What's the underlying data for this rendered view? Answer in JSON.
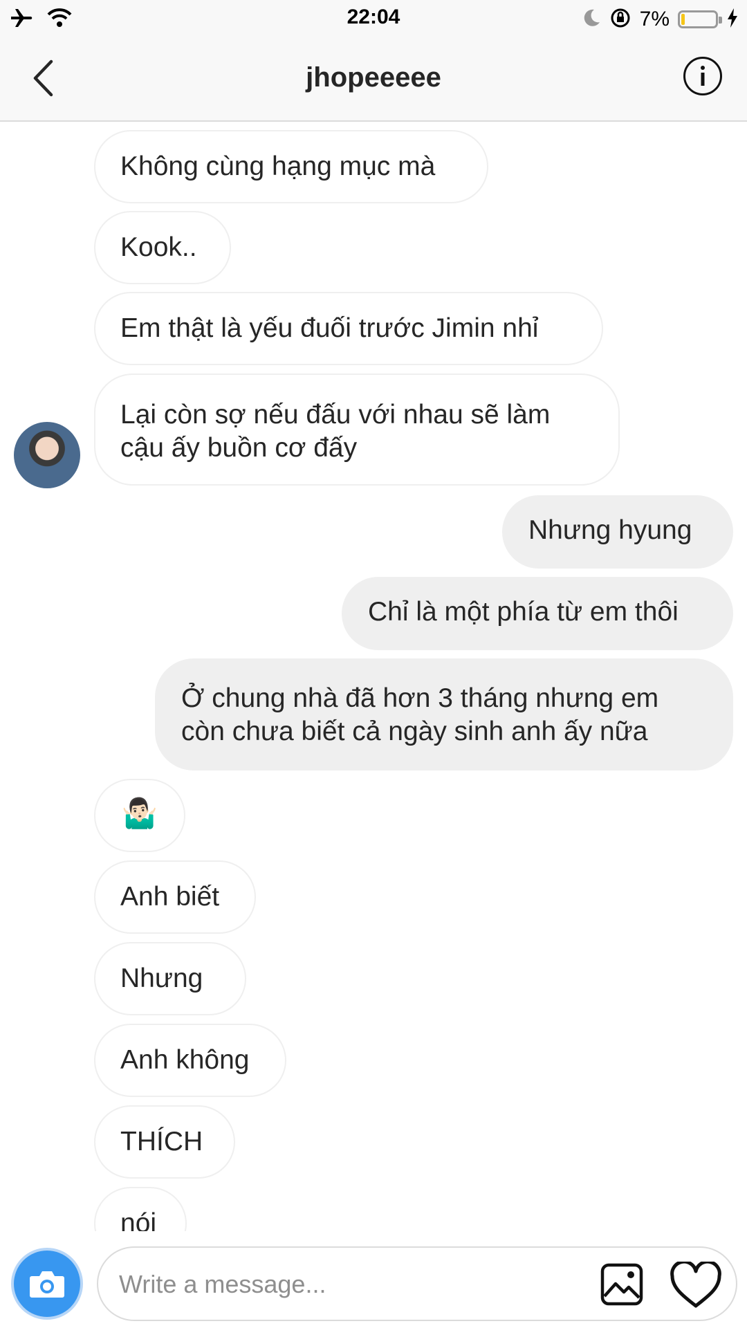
{
  "status_bar": {
    "time": "22:04",
    "battery_percent": "7%",
    "battery_level": 0.07
  },
  "header": {
    "title": "jhopeeeee"
  },
  "messages": [
    {
      "side": "in",
      "text": "Không cùng hạng mục mà"
    },
    {
      "side": "in",
      "text": "Kook.."
    },
    {
      "side": "in",
      "text": "Em thật là yếu đuối trước Jimin nhỉ"
    },
    {
      "side": "in",
      "text": "Lại còn sợ nếu đấu với nhau sẽ làm cậu ấy buồn cơ đấy"
    },
    {
      "side": "out",
      "text": "Nhưng hyung"
    },
    {
      "side": "out",
      "text": "Chỉ là một phía từ em thôi"
    },
    {
      "side": "out",
      "text": "Ở chung nhà đã hơn 3 tháng nhưng em còn chưa biết cả ngày sinh anh ấy nữa"
    },
    {
      "side": "in",
      "text": "🤷🏻‍♂️"
    },
    {
      "side": "in",
      "text": "Anh biết"
    },
    {
      "side": "in",
      "text": "Nhưng"
    },
    {
      "side": "in",
      "text": "Anh không"
    },
    {
      "side": "in",
      "text": "THÍCH"
    },
    {
      "side": "in",
      "text": "nói"
    }
  ],
  "composer": {
    "placeholder": "Write a message..."
  },
  "colors": {
    "accent": "#3897f0",
    "incoming_border": "#efefef",
    "outgoing_bg": "#efefef"
  },
  "icons": [
    "airplane-icon",
    "wifi-icon",
    "moon-icon",
    "orientation-lock-icon",
    "charging-icon",
    "back-chevron-icon",
    "info-icon",
    "camera-icon",
    "gallery-icon",
    "heart-icon"
  ]
}
